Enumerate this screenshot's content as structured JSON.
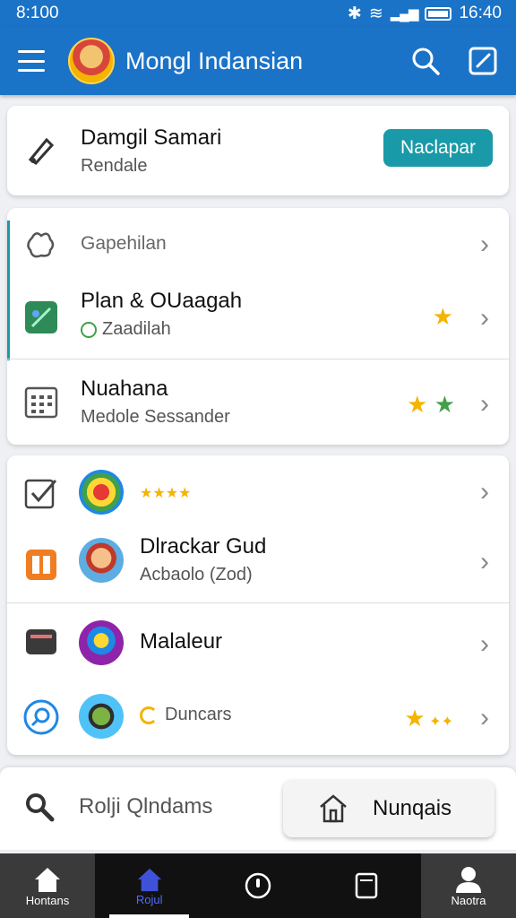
{
  "status": {
    "time": "8:100",
    "right_time": "16:40"
  },
  "appbar": {
    "title": "Mongl Indansian"
  },
  "profile_card": {
    "name": "Damgil Samari",
    "subtitle": "Rendale",
    "button": "Naclapar"
  },
  "list1": [
    {
      "title": "Gapehilan",
      "subtitle": ""
    },
    {
      "title": "Plan & OUaagah",
      "subtitle": "Zaadilah"
    },
    {
      "title": "Nuahana",
      "subtitle": "Medole Sessander"
    }
  ],
  "list2": [
    {
      "title": "",
      "subtitle": ""
    },
    {
      "title": "Dlrackar Gud",
      "subtitle": "Acbaolo (Zod)"
    },
    {
      "title": "Malaleur",
      "subtitle": ""
    },
    {
      "title": "",
      "subtitle": "Duncars"
    }
  ],
  "bottom": {
    "search_text": "Rolji Qlndams",
    "button": "Nunqais"
  },
  "nav": [
    {
      "label": "Hontans"
    },
    {
      "label": "Rojul"
    },
    {
      "label": ""
    },
    {
      "label": ""
    },
    {
      "label": "Naotra"
    }
  ],
  "colors": {
    "primary": "#1b73c8",
    "teal": "#1a9aa8",
    "star_yellow": "#f4b400",
    "star_green": "#43a047"
  }
}
